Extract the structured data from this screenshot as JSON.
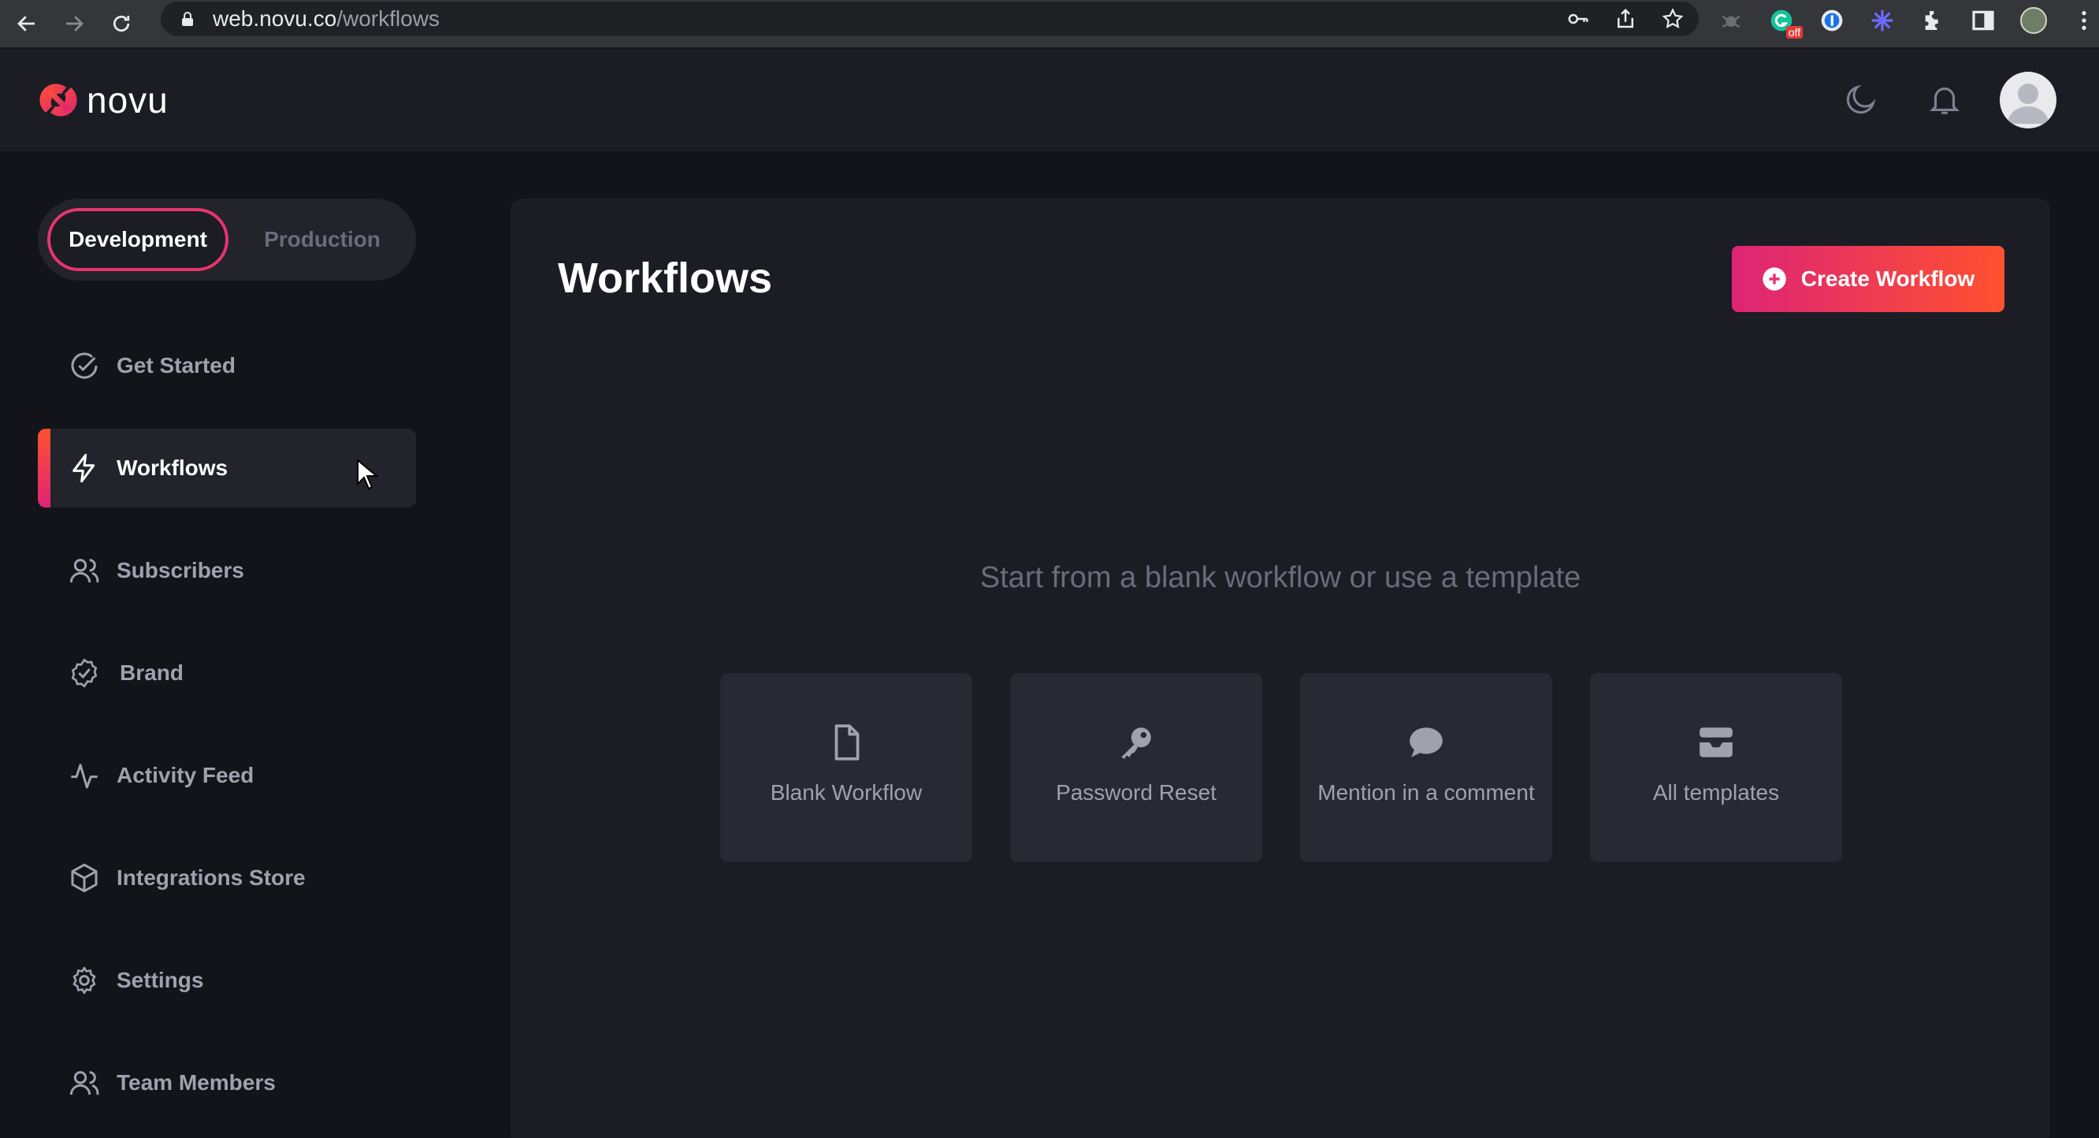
{
  "browser": {
    "url_host": "web.novu.co",
    "url_path": "/workflows",
    "extension_badge": "off"
  },
  "header": {
    "brand": "novu"
  },
  "environment": {
    "options": [
      "Development",
      "Production"
    ],
    "selected": "Development"
  },
  "sidebar": {
    "items": [
      {
        "label": "Get Started",
        "icon": "check-circle-icon"
      },
      {
        "label": "Workflows",
        "icon": "bolt-icon",
        "active": true
      },
      {
        "label": "Subscribers",
        "icon": "users-icon"
      },
      {
        "label": "Brand",
        "icon": "badge-check-icon"
      },
      {
        "label": "Activity Feed",
        "icon": "activity-icon"
      },
      {
        "label": "Integrations Store",
        "icon": "box-icon"
      },
      {
        "label": "Settings",
        "icon": "gear-icon"
      },
      {
        "label": "Team Members",
        "icon": "team-icon"
      }
    ]
  },
  "main": {
    "title": "Workflows",
    "create_button": "Create Workflow",
    "empty_text": "Start from a blank workflow or use a template",
    "templates": [
      {
        "label": "Blank Workflow",
        "icon": "file-icon"
      },
      {
        "label": "Password Reset",
        "icon": "key-icon"
      },
      {
        "label": "Mention in a comment",
        "icon": "comment-icon"
      },
      {
        "label": "All templates",
        "icon": "templates-icon"
      }
    ]
  },
  "colors": {
    "accent_start": "#dd2476",
    "accent_end": "#ff512f",
    "background": "#13131a",
    "panel": "#1c1c24",
    "muted_text": "#a1a1ae"
  }
}
